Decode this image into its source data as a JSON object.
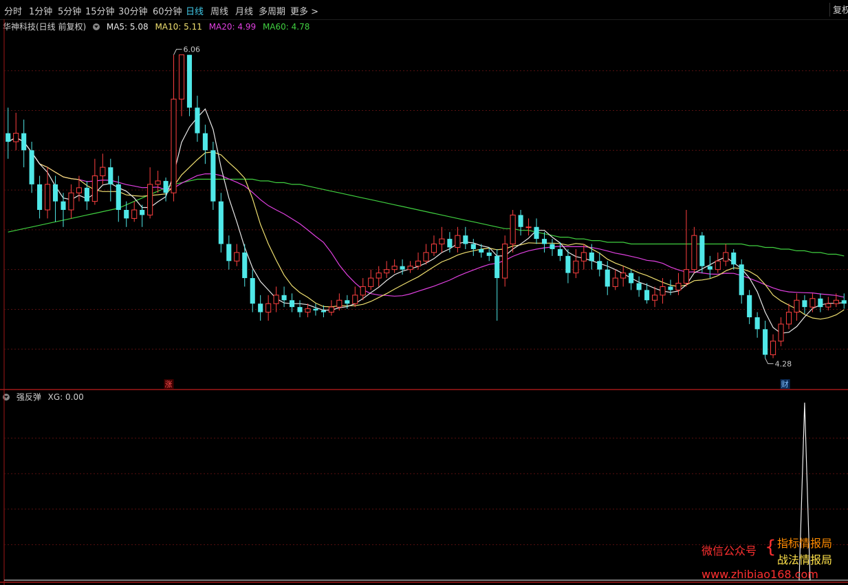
{
  "toolbar": {
    "tabs": [
      {
        "label": "分时"
      },
      {
        "label": "1分钟"
      },
      {
        "label": "5分钟"
      },
      {
        "label": "15分钟"
      },
      {
        "label": "30分钟"
      },
      {
        "label": "60分钟"
      },
      {
        "label": "日线",
        "active": true
      },
      {
        "label": "周线"
      },
      {
        "label": "月线"
      },
      {
        "label": "多周期"
      },
      {
        "label": "更多 >"
      }
    ],
    "right_button": "复权"
  },
  "main_panel": {
    "stock_title": "华神科技(日线 前复权)",
    "ma": [
      {
        "label": "MA5: 5.08",
        "color": "#e8e8e8"
      },
      {
        "label": "MA10: 5.11",
        "color": "#f0e070"
      },
      {
        "label": "MA20: 4.99",
        "color": "#e040e0"
      },
      {
        "label": "MA60: 4.78",
        "color": "#40d040"
      }
    ],
    "high_label": "6.06",
    "low_label": "4.28",
    "badge_up": "涨",
    "badge_fin": "财"
  },
  "sub_panel": {
    "indicator_title": "强反弹",
    "value_label": "XG: 0.00"
  },
  "watermark": {
    "left": "微信公众号",
    "brace": "{",
    "line1": "指标情报局",
    "line2": "战法情报局",
    "url": "www.zhibiao168.com"
  },
  "colors": {
    "up": "#ff4040",
    "down": "#50e8e8",
    "ma5": "#e8e8e8",
    "ma10": "#f0e070",
    "ma20": "#e040e0",
    "ma60": "#40d040",
    "grid": "#5a1010"
  },
  "chart_data": {
    "type": "candlestick",
    "price_range": [
      4.1,
      6.2
    ],
    "candles": [
      [
        5.6,
        5.55,
        5.75,
        5.45
      ],
      [
        5.55,
        5.6,
        5.72,
        5.5
      ],
      [
        5.6,
        5.5,
        5.68,
        5.4
      ],
      [
        5.5,
        5.3,
        5.55,
        5.25
      ],
      [
        5.3,
        5.15,
        5.35,
        5.1
      ],
      [
        5.15,
        5.3,
        5.4,
        5.1
      ],
      [
        5.3,
        5.2,
        5.35,
        5.08
      ],
      [
        5.2,
        5.15,
        5.25,
        5.05
      ],
      [
        5.15,
        5.25,
        5.3,
        5.1
      ],
      [
        5.25,
        5.28,
        5.35,
        5.2
      ],
      [
        5.28,
        5.2,
        5.32,
        5.15
      ],
      [
        5.2,
        5.35,
        5.45,
        5.18
      ],
      [
        5.35,
        5.4,
        5.48,
        5.3
      ],
      [
        5.4,
        5.3,
        5.45,
        5.2
      ],
      [
        5.3,
        5.15,
        5.35,
        5.08
      ],
      [
        5.15,
        5.1,
        5.2,
        5.05
      ],
      [
        5.1,
        5.15,
        5.2,
        5.08
      ],
      [
        5.15,
        5.12,
        5.18,
        5.05
      ],
      [
        5.12,
        5.3,
        5.4,
        5.1
      ],
      [
        5.3,
        5.32,
        5.38,
        5.25
      ],
      [
        5.32,
        5.25,
        5.34,
        5.2
      ],
      [
        5.25,
        5.8,
        6.06,
        5.2
      ],
      [
        5.8,
        6.06,
        6.06,
        5.7
      ],
      [
        6.06,
        5.75,
        6.06,
        5.7
      ],
      [
        5.75,
        5.6,
        5.82,
        5.55
      ],
      [
        5.6,
        5.5,
        5.65,
        5.42
      ],
      [
        5.5,
        5.2,
        5.55,
        5.15
      ],
      [
        5.2,
        4.95,
        5.25,
        4.9
      ],
      [
        4.95,
        4.85,
        5.0,
        4.8
      ],
      [
        4.85,
        4.9,
        4.95,
        4.82
      ],
      [
        4.9,
        4.75,
        4.95,
        4.7
      ],
      [
        4.75,
        4.6,
        4.8,
        4.55
      ],
      [
        4.6,
        4.55,
        4.65,
        4.5
      ],
      [
        4.55,
        4.6,
        4.65,
        4.5
      ],
      [
        4.6,
        4.65,
        4.7,
        4.55
      ],
      [
        4.65,
        4.62,
        4.7,
        4.58
      ],
      [
        4.62,
        4.58,
        4.66,
        4.55
      ],
      [
        4.58,
        4.55,
        4.62,
        4.52
      ],
      [
        4.55,
        4.57,
        4.6,
        4.52
      ],
      [
        4.57,
        4.56,
        4.6,
        4.53
      ],
      [
        4.56,
        4.55,
        4.59,
        4.52
      ],
      [
        4.55,
        4.58,
        4.62,
        4.53
      ],
      [
        4.58,
        4.62,
        4.66,
        4.56
      ],
      [
        4.62,
        4.6,
        4.65,
        4.57
      ],
      [
        4.6,
        4.65,
        4.7,
        4.58
      ],
      [
        4.65,
        4.7,
        4.75,
        4.62
      ],
      [
        4.7,
        4.75,
        4.8,
        4.68
      ],
      [
        4.75,
        4.78,
        4.82,
        4.7
      ],
      [
        4.78,
        4.8,
        4.85,
        4.75
      ],
      [
        4.8,
        4.82,
        4.86,
        4.78
      ],
      [
        4.82,
        4.8,
        4.86,
        4.77
      ],
      [
        4.8,
        4.82,
        4.85,
        4.78
      ],
      [
        4.82,
        4.85,
        4.9,
        4.8
      ],
      [
        4.85,
        4.9,
        4.95,
        4.83
      ],
      [
        4.9,
        4.95,
        5.0,
        4.88
      ],
      [
        4.95,
        4.98,
        5.05,
        4.9
      ],
      [
        4.98,
        4.93,
        5.02,
        4.9
      ],
      [
        4.93,
        5.0,
        5.05,
        4.9
      ],
      [
        5.0,
        4.95,
        5.05,
        4.92
      ],
      [
        4.95,
        4.92,
        4.98,
        4.88
      ],
      [
        4.92,
        4.9,
        4.95,
        4.87
      ],
      [
        4.9,
        4.88,
        4.93,
        4.85
      ],
      [
        4.88,
        4.75,
        4.92,
        4.5
      ],
      [
        4.75,
        4.95,
        5.0,
        4.7
      ],
      [
        4.95,
        5.12,
        5.15,
        4.9
      ],
      [
        5.12,
        5.05,
        5.15,
        5.0
      ],
      [
        5.05,
        5.05,
        5.1,
        5.0
      ],
      [
        5.05,
        4.98,
        5.1,
        4.95
      ],
      [
        4.98,
        4.95,
        5.02,
        4.9
      ],
      [
        4.95,
        4.92,
        4.98,
        4.88
      ],
      [
        4.92,
        4.88,
        4.96,
        4.85
      ],
      [
        4.88,
        4.78,
        4.92,
        4.72
      ],
      [
        4.78,
        4.85,
        4.92,
        4.75
      ],
      [
        4.85,
        4.9,
        4.95,
        4.8
      ],
      [
        4.9,
        4.85,
        4.95,
        4.8
      ],
      [
        4.85,
        4.8,
        4.9,
        4.76
      ],
      [
        4.8,
        4.7,
        4.85,
        4.65
      ],
      [
        4.7,
        4.75,
        4.8,
        4.68
      ],
      [
        4.75,
        4.78,
        4.82,
        4.7
      ],
      [
        4.78,
        4.72,
        4.8,
        4.68
      ],
      [
        4.72,
        4.68,
        4.76,
        4.64
      ],
      [
        4.68,
        4.62,
        4.72,
        4.6
      ],
      [
        4.62,
        4.65,
        4.7,
        4.58
      ],
      [
        4.65,
        4.7,
        4.75,
        4.6
      ],
      [
        4.7,
        4.68,
        4.74,
        4.65
      ],
      [
        4.68,
        4.72,
        4.78,
        4.65
      ],
      [
        4.72,
        4.8,
        5.15,
        4.7
      ],
      [
        4.8,
        5.0,
        5.05,
        4.78
      ],
      [
        5.0,
        4.82,
        5.02,
        4.78
      ],
      [
        4.82,
        4.8,
        4.88,
        4.75
      ],
      [
        4.8,
        4.85,
        4.9,
        4.78
      ],
      [
        4.85,
        4.9,
        4.95,
        4.82
      ],
      [
        4.9,
        4.83,
        4.92,
        4.8
      ],
      [
        4.83,
        4.65,
        4.86,
        4.6
      ],
      [
        4.65,
        4.52,
        4.68,
        4.48
      ],
      [
        4.52,
        4.45,
        4.55,
        4.4
      ],
      [
        4.45,
        4.3,
        4.5,
        4.28
      ],
      [
        4.3,
        4.38,
        4.42,
        4.28
      ],
      [
        4.38,
        4.48,
        4.52,
        4.35
      ],
      [
        4.48,
        4.55,
        4.6,
        4.45
      ],
      [
        4.55,
        4.62,
        4.66,
        4.5
      ],
      [
        4.62,
        4.58,
        4.65,
        4.54
      ],
      [
        4.58,
        4.63,
        4.66,
        4.55
      ],
      [
        4.63,
        4.58,
        4.66,
        4.55
      ],
      [
        4.58,
        4.6,
        4.64,
        4.56
      ],
      [
        4.6,
        4.62,
        4.66,
        4.58
      ],
      [
        4.62,
        4.6,
        4.66,
        4.57
      ]
    ],
    "ma60": [
      5.02,
      5.03,
      5.04,
      5.05,
      5.06,
      5.07,
      5.08,
      5.09,
      5.1,
      5.11,
      5.12,
      5.13,
      5.14,
      5.15,
      5.16,
      5.18,
      5.2,
      5.22,
      5.24,
      5.26,
      5.28,
      5.3,
      5.31,
      5.32,
      5.33,
      5.33,
      5.33,
      5.33,
      5.33,
      5.33,
      5.33,
      5.33,
      5.32,
      5.32,
      5.31,
      5.31,
      5.3,
      5.3,
      5.29,
      5.28,
      5.27,
      5.26,
      5.25,
      5.24,
      5.23,
      5.22,
      5.21,
      5.2,
      5.19,
      5.18,
      5.17,
      5.16,
      5.15,
      5.14,
      5.13,
      5.12,
      5.11,
      5.1,
      5.09,
      5.08,
      5.07,
      5.06,
      5.05,
      5.04,
      5.04,
      5.03,
      5.03,
      5.02,
      5.01,
      5.0,
      4.99,
      4.99,
      4.98,
      4.98,
      4.97,
      4.97,
      4.96,
      4.96,
      4.96,
      4.95,
      4.95,
      4.95,
      4.95,
      4.95,
      4.95,
      4.95,
      4.95,
      4.95,
      4.95,
      4.95,
      4.95,
      4.95,
      4.95,
      4.95,
      4.94,
      4.94,
      4.93,
      4.93,
      4.92,
      4.92,
      4.91,
      4.91,
      4.9,
      4.9,
      4.89,
      4.89,
      4.88
    ],
    "xg": [
      0,
      0,
      0,
      0,
      0,
      0,
      0,
      0,
      0,
      0,
      0,
      0,
      0,
      0,
      0,
      0,
      0,
      0,
      0,
      0,
      0,
      0,
      0,
      0,
      0,
      0,
      0,
      0,
      0,
      0,
      0,
      0,
      0,
      0,
      0,
      0,
      0,
      0,
      0,
      0,
      0,
      0,
      0,
      0,
      0,
      0,
      0,
      0,
      0,
      0,
      0,
      0,
      0,
      0,
      0,
      0,
      0,
      0,
      0,
      0,
      0,
      0,
      0,
      0,
      0,
      0,
      0,
      0,
      0,
      0,
      0,
      0,
      0,
      0,
      0,
      0,
      0,
      0,
      0,
      0,
      0,
      0,
      0,
      0,
      0,
      0,
      0,
      0,
      0,
      0,
      0,
      0,
      0,
      0,
      0,
      0,
      0,
      0,
      0,
      0,
      0,
      1,
      0,
      0,
      0,
      0,
      0,
      0,
      0,
      0,
      0
    ]
  }
}
